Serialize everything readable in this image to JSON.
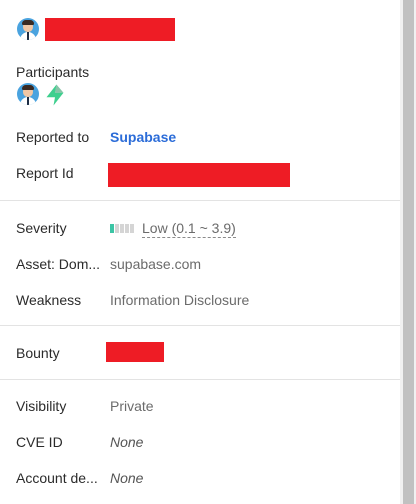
{
  "header": {
    "avatar_icon": "user-avatar-icon"
  },
  "participants": {
    "label": "Participants",
    "icons": [
      "user-avatar-icon",
      "supabase-logo-icon"
    ]
  },
  "reported_to": {
    "label": "Reported to",
    "value": "Supabase"
  },
  "report_id": {
    "label": "Report Id"
  },
  "severity": {
    "label": "Severity",
    "value": "Low (0.1 ~ 3.9)",
    "level_bars_filled": 1,
    "level_bars_total": 5,
    "colors": {
      "filled": "#3cc5a5",
      "empty": "#d5d5d5"
    }
  },
  "asset": {
    "label": "Asset: Dom...",
    "value": "supabase.com"
  },
  "weakness": {
    "label": "Weakness",
    "value": "Information Disclosure"
  },
  "bounty": {
    "label": "Bounty"
  },
  "visibility": {
    "label": "Visibility",
    "value": "Private"
  },
  "cve": {
    "label": "CVE ID",
    "value": "None"
  },
  "account": {
    "label": "Account de...",
    "value": "None"
  },
  "colors": {
    "link": "#2b6cd8",
    "redaction": "#ee1c25",
    "supabase_green": "#3ecf8e"
  }
}
